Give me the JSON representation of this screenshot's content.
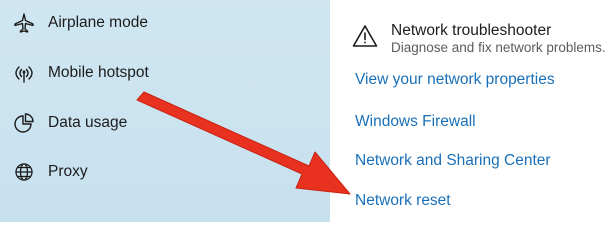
{
  "sidebar": {
    "items": [
      {
        "label": "Airplane mode",
        "icon": "airplane-icon"
      },
      {
        "label": "Mobile hotspot",
        "icon": "hotspot-icon"
      },
      {
        "label": "Data usage",
        "icon": "data-usage-icon"
      },
      {
        "label": "Proxy",
        "icon": "globe-icon"
      }
    ]
  },
  "troubleshooter": {
    "title": "Network troubleshooter",
    "description": "Diagnose and fix network problems.",
    "icon": "warning-icon"
  },
  "links": [
    "View your network properties",
    "Windows Firewall",
    "Network and Sharing Center",
    "Network reset"
  ],
  "annotation": {
    "arrow_color": "#e8321f",
    "icon": "red-arrow-icon"
  },
  "colors": {
    "link": "#1a70b8",
    "sidebar_bg": "#cfe6f1"
  }
}
